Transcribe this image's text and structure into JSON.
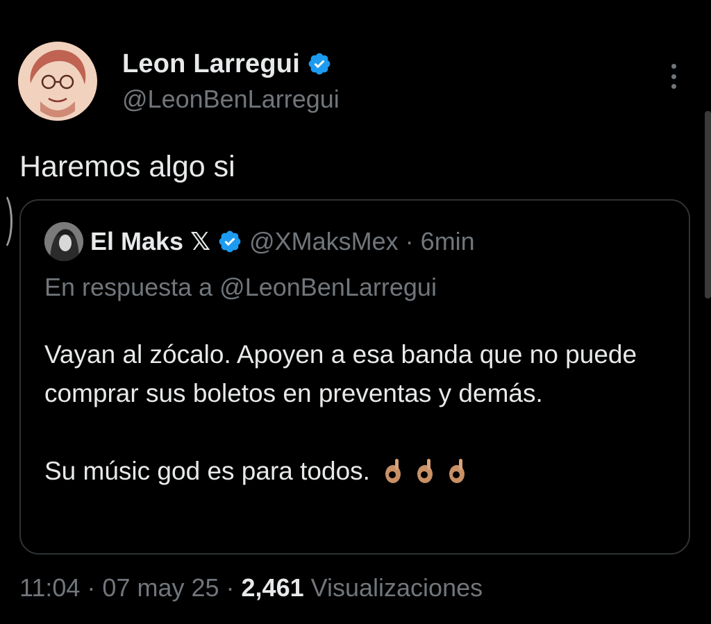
{
  "tweet": {
    "author": {
      "name": "Leon Larregui",
      "handle": "@LeonBenLarregui",
      "verified": true
    },
    "text": "Haremos algo si",
    "quote": {
      "author_name": "El Maks",
      "author_name_suffix": "𝕏",
      "handle": "@XMaksMex",
      "separator": "·",
      "time": "6min",
      "reply_prefix": "En respuesta a",
      "reply_handle": "@LeonBenLarregui",
      "body_lines": [
        "Vayan al zócalo. Apoyen a esa banda que no puede comprar sus boletos en preventas y demás.",
        "Su músic god es para todos."
      ],
      "emoji": [
        "ok-hand",
        "ok-hand",
        "ok-hand"
      ]
    },
    "meta": {
      "time": "11:04",
      "sep1": "·",
      "date": "07 may 25",
      "sep2": "·",
      "views_count": "2,461",
      "views_label": "Visualizaciones"
    }
  },
  "colors": {
    "background": "#000000",
    "text_primary": "#e7e9ea",
    "text_secondary": "#71767b",
    "border": "#2f3336",
    "verified_blue": "#1d9bf0"
  },
  "icons": {
    "verified": "verified-badge-icon",
    "more": "more-vertical-icon",
    "emoji": "ok-hand-emoji"
  }
}
